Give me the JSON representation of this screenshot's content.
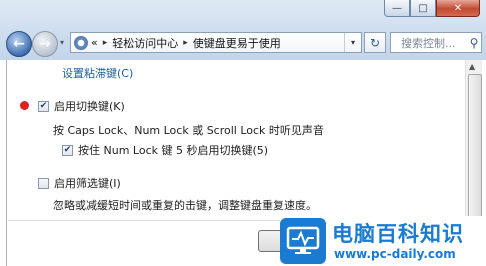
{
  "window": {
    "controls": {
      "minimize": "—",
      "maximize": "□",
      "close": "✕"
    }
  },
  "navigation": {
    "back_icon": "←",
    "forward_icon": "→",
    "history_dropdown": "▾",
    "address_icon": "control-panel-icon",
    "address_prefix": "«",
    "breadcrumb": [
      "轻松访问中心",
      "使键盘更易于使用"
    ],
    "breadcrumb_separator": "▸",
    "address_dropdown": "▾",
    "refresh_icon": "↻",
    "search_placeholder": "搜索控制...",
    "search_icon": "⚲"
  },
  "content": {
    "link_sticky_keys": "设置粘滞键(C)",
    "toggle_keys": {
      "checked": true,
      "label": "启用切换键(K)",
      "description": "按 Caps Lock、Num Lock 或 Scroll Lock 时听见声音",
      "sub_option": {
        "checked": true,
        "label": "按住 Num Lock 键 5 秒启用切换键(5)"
      }
    },
    "filter_keys": {
      "checked": false,
      "label": "启用筛选键(I)",
      "description": "忽略或减缓短时间或重复的击键，调整键盘重复速度。"
    },
    "bottom_button": "确"
  },
  "watermark": {
    "title": "电脑百科知识",
    "url": "www.pc-daily.com"
  },
  "colors": {
    "link": "#1d5ea7",
    "bullet": "#e02020",
    "watermark": "#1a7bd1"
  }
}
